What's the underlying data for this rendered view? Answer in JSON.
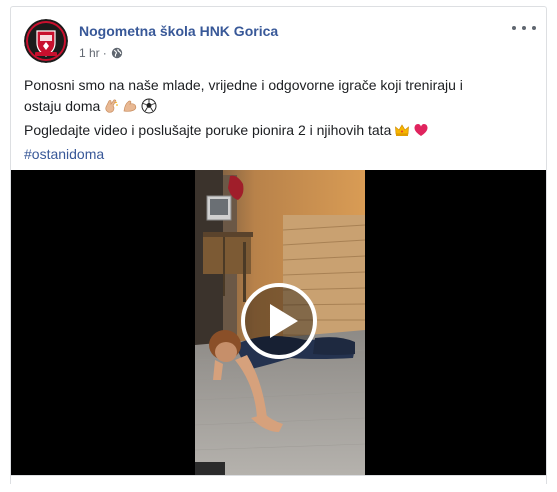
{
  "post": {
    "page_name": "Nogometna škola HNK Gorica",
    "time": "1 hr",
    "separator": "·",
    "privacy_icon": "globe-icon",
    "more_icon": "more-options-icon",
    "text_line_1": "Ponosni smo na naše mlade, vrijedne i odgovorne igrače koji treniraju i",
    "text_line_2": "ostaju doma",
    "text_line_3": "Pogledajte video i poslušajte poruke pionira 2 i njihovih tata",
    "hashtag": "#ostanidoma",
    "emojis_line_2": [
      "clapping-hands-emoji",
      "flexed-biceps-emoji",
      "soccer-ball-emoji"
    ],
    "emojis_line_3": [
      "crown-emoji",
      "red-heart-emoji"
    ]
  },
  "video": {
    "play_icon": "play-icon"
  },
  "colors": {
    "link": "#385898",
    "text": "#1c1e21",
    "meta": "#616770",
    "border": "#dddfe2"
  }
}
